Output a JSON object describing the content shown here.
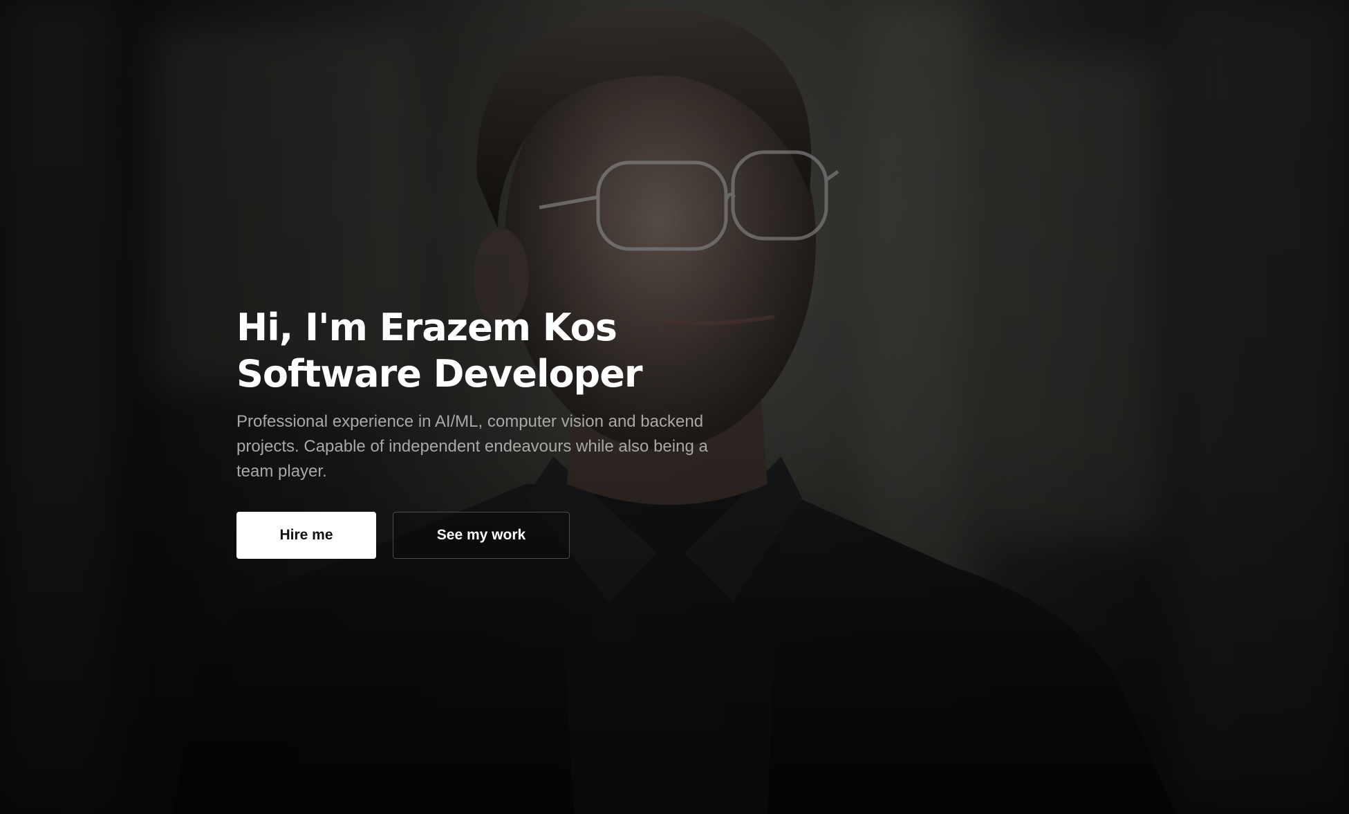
{
  "hero": {
    "headline_line1": "Hi, I'm Erazem Kos",
    "headline_line2": "Software Developer",
    "description": "Professional experience in AI/ML, computer vision and backend projects. Capable of independent endeavours while also being a team player.",
    "primary_button_label": "Hire me",
    "secondary_button_label": "See my work"
  },
  "colors": {
    "headline": "#ffffff",
    "description": "#a8a8a6",
    "primary_button_bg": "#ffffff",
    "primary_button_text": "#111111",
    "secondary_button_border": "#4a4a48"
  }
}
